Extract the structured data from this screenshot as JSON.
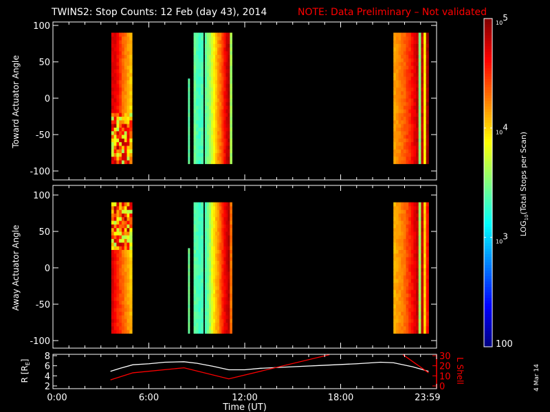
{
  "title": "TWINS2: Stop Counts: 12 Feb (day  43), 2014",
  "note": "NOTE: Data Preliminary – Not validated",
  "side_date": "4 Mar 14",
  "colors": {
    "background": "#000000",
    "axes": "#ffffff",
    "note": "#ff0000",
    "lshell": "#ff0000",
    "radius": "#ffffff"
  },
  "chart_data": [
    {
      "type": "heatmap",
      "name": "toward",
      "ylabel": "Toward Actuator Angle",
      "ylim": [
        -100,
        100
      ],
      "yticks": [
        "100",
        "50",
        "0",
        "-50",
        "-100"
      ],
      "ytick_values": [
        100,
        50,
        0,
        -50,
        -100
      ],
      "xlim_hours": [
        0,
        24
      ],
      "data_angle_range": [
        -90,
        90
      ],
      "blocks": [
        {
          "t0": 3.65,
          "t1": 4.95,
          "log10": [
            4.75,
            4.7,
            4.6,
            4.45,
            4.3,
            4.2,
            4.1,
            4.0
          ],
          "noisy_lower": true
        },
        {
          "t0": 8.45,
          "t1": 8.55,
          "log10": [
            3.4
          ],
          "angle_max": 27
        },
        {
          "t0": 8.8,
          "t1": 9.4,
          "log10": [
            3.45,
            3.35,
            3.3,
            3.35
          ]
        },
        {
          "t0": 9.5,
          "t1": 11.2,
          "log10": [
            3.4,
            3.5,
            3.6,
            3.75,
            3.9,
            4.05,
            4.2,
            4.3,
            4.45,
            4.6,
            4.75,
            4.85,
            3.6
          ]
        },
        {
          "t0": 21.3,
          "t1": 23.5,
          "log10": [
            4.15,
            4.2,
            4.25,
            4.3,
            4.35,
            4.45,
            4.5,
            4.6,
            4.7,
            4.8,
            3.5,
            4.8,
            3.9,
            4.9
          ]
        }
      ]
    },
    {
      "type": "heatmap",
      "name": "away",
      "ylabel": "Away Actuator Angle",
      "ylim": [
        -100,
        100
      ],
      "yticks": [
        "100",
        "50",
        "0",
        "-50",
        "-100"
      ],
      "ytick_values": [
        100,
        50,
        0,
        -50,
        -100
      ],
      "xlim_hours": [
        0,
        24
      ],
      "data_angle_range": [
        -90,
        90
      ],
      "blocks": [
        {
          "t0": 3.65,
          "t1": 4.95,
          "log10": [
            4.75,
            4.6,
            4.5,
            4.4,
            4.3,
            4.2,
            4.1,
            4.0
          ],
          "noisy_upper": true
        },
        {
          "t0": 8.45,
          "t1": 8.55,
          "log10": [
            3.45
          ],
          "angle_max": 27
        },
        {
          "t0": 8.8,
          "t1": 9.4,
          "log10": [
            3.4,
            3.35,
            3.3,
            3.35
          ]
        },
        {
          "t0": 9.5,
          "t1": 11.2,
          "log10": [
            3.35,
            3.45,
            3.6,
            3.8,
            3.95,
            4.1,
            4.2,
            4.35,
            4.5,
            4.65,
            4.75,
            4.85,
            4.3
          ]
        },
        {
          "t0": 21.3,
          "t1": 23.5,
          "log10": [
            4.1,
            4.15,
            4.2,
            4.25,
            4.3,
            4.4,
            4.5,
            4.6,
            4.7,
            4.8,
            3.6,
            4.8,
            4.0,
            4.6
          ]
        }
      ]
    },
    {
      "type": "line",
      "name": "orbit",
      "ylabel_left": "R [R",
      "ylabel_left_sub": "E",
      "ylabel_left_end": "]",
      "ylabel_right": "L Shell",
      "ylim_left": [
        1.5,
        8.5
      ],
      "ylim_right": [
        -2,
        32
      ],
      "yticks_left": [
        "8",
        "6",
        "4",
        "2"
      ],
      "ytick_left_values": [
        8,
        6,
        4,
        2
      ],
      "yticks_right": [
        "30",
        "20",
        "10",
        "0"
      ],
      "ytick_right_values": [
        30,
        20,
        10,
        0
      ],
      "xlabel": "Time (UT)",
      "xticks": [
        "0:00",
        "6:00",
        "12:00",
        "18:00",
        "23:59"
      ],
      "xtick_values": [
        0,
        6,
        12,
        18,
        23.98
      ],
      "series": [
        {
          "name": "R",
          "color": "#ffffff",
          "x": [
            3.6,
            4.2,
            5.0,
            6.0,
            7.0,
            8.2,
            9.0,
            10.0,
            11.0,
            12.0,
            13.0,
            15.0,
            17.0,
            19.0,
            20.5,
            21.3,
            22.5,
            23.5
          ],
          "y": [
            4.9,
            5.5,
            6.2,
            6.4,
            6.7,
            6.8,
            6.5,
            5.9,
            5.2,
            5.2,
            5.5,
            5.8,
            6.1,
            6.4,
            6.7,
            6.6,
            5.8,
            4.9
          ]
        },
        {
          "name": "L Shell",
          "color": "#ff0000",
          "x": [
            3.6,
            5.0,
            8.2,
            11.0,
            17.3
          ],
          "y": [
            6,
            13,
            18,
            7,
            31
          ],
          "axis": "right"
        },
        {
          "name": "L Shell (end)",
          "color": "#ff0000",
          "x": [
            21.9,
            23.5
          ],
          "y": [
            31,
            13
          ],
          "axis": "right"
        }
      ]
    }
  ],
  "colorbar": {
    "label": "LOG",
    "label_sub": "10",
    "label_end": "(Total Stops per Scan)",
    "range_log10": [
      2,
      5
    ],
    "ticks": [
      {
        "base": "10",
        "exp": "5",
        "value": 5
      },
      {
        "base": "10",
        "exp": "4",
        "value": 4
      },
      {
        "base": "10",
        "exp": "3",
        "value": 3
      }
    ],
    "bottom_label": "100"
  }
}
